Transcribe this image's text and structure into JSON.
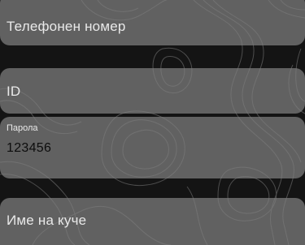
{
  "form": {
    "phone": {
      "placeholder": "Телефонен номер"
    },
    "id": {
      "placeholder": "ID"
    },
    "password": {
      "label": "Парола",
      "value": "123456"
    },
    "dog_name": {
      "placeholder": "Име на куче"
    }
  },
  "colors": {
    "background": "#141414",
    "field_fill": "#808080",
    "text_light": "#f2f2f2",
    "text_dark": "#0d0d0d",
    "contour_lines": "#9a9a9a"
  }
}
